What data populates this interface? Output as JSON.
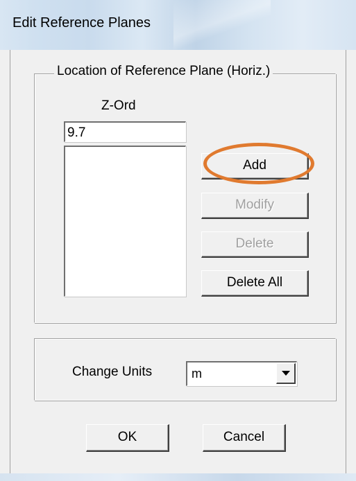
{
  "window": {
    "title": "Edit Reference Planes"
  },
  "location_group": {
    "legend": "Location of Reference Plane (Horiz.)",
    "zord_label": "Z-Ord",
    "zord_value": "9.7",
    "list_items": []
  },
  "buttons": {
    "add": "Add",
    "modify": "Modify",
    "delete": "Delete",
    "delete_all": "Delete All",
    "ok": "OK",
    "cancel": "Cancel"
  },
  "units_group": {
    "label": "Change Units",
    "selected": "m"
  },
  "colors": {
    "highlight": "#e07a2f",
    "disabled_text": "#a0a0a0"
  },
  "icons": {
    "dropdown": "chevron-down-icon"
  }
}
